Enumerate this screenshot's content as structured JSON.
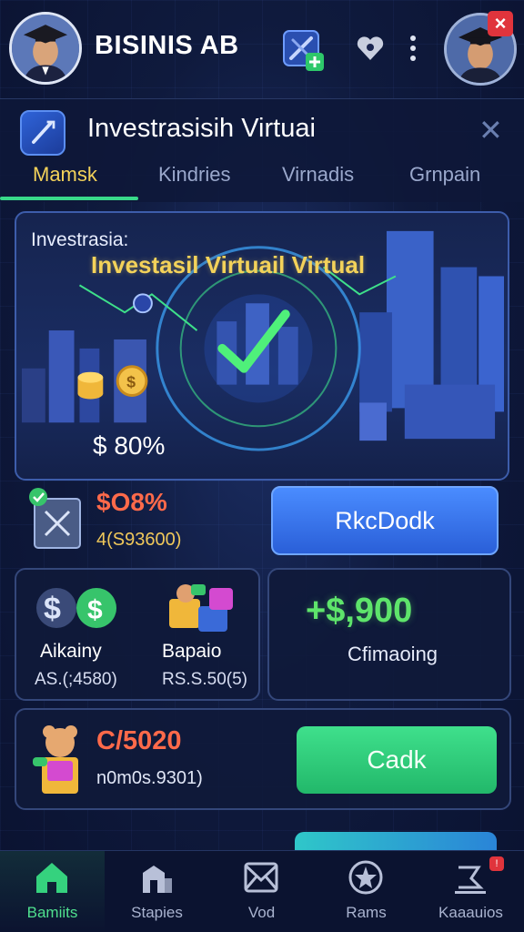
{
  "header": {
    "brand": "BISINIS AB"
  },
  "section": {
    "title": "Investrasisih Virtuai",
    "tabs": [
      {
        "label": "Mamsk",
        "active": true
      },
      {
        "label": "Kindries",
        "active": false
      },
      {
        "label": "Virnadis",
        "active": false
      },
      {
        "label": "Grnpain",
        "active": false
      }
    ]
  },
  "hero": {
    "label": "Investrasia:",
    "title": "Investasil Virtuail Virtual",
    "percent": "$ 80%"
  },
  "stat": {
    "value": "$O8%",
    "sub": "4(S93600)",
    "button": "RkcDodk"
  },
  "mini_cards": [
    {
      "name": "Aikainy",
      "amount": "AS.(;4580)"
    },
    {
      "name": "Bapaio",
      "amount": "RS.S.50(5)"
    }
  ],
  "gain": {
    "amount": "+$,900",
    "label": "Cfimaoing"
  },
  "card3": {
    "value": "C/5020",
    "sub": "n0m0s.9301)",
    "button": "Cadk"
  },
  "nav": [
    {
      "label": "Bamiits",
      "icon": "home-icon",
      "active": true
    },
    {
      "label": "Stapies",
      "icon": "building-icon",
      "active": false
    },
    {
      "label": "Vod",
      "icon": "mail-icon",
      "active": false
    },
    {
      "label": "Rams",
      "icon": "star-badge-icon",
      "active": false
    },
    {
      "label": "Kaaauios",
      "icon": "chart-icon",
      "active": false
    }
  ],
  "colors": {
    "accent_green": "#39d98a",
    "accent_yellow": "#f3d25a",
    "accent_red": "#ff6a4a",
    "button_blue": "#3a76f0",
    "background": "#0f1a3d"
  }
}
